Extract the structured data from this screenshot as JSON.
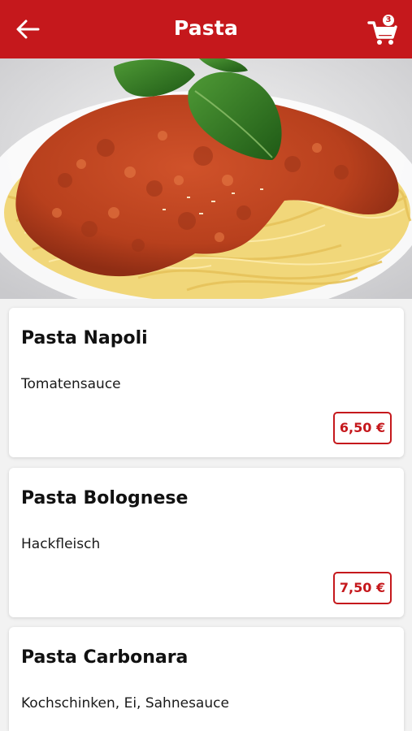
{
  "header": {
    "title": "Pasta",
    "cart_count": "3",
    "background_color": "#c5181c",
    "back_icon": "arrow-left-icon",
    "cart_icon": "shopping-cart-icon"
  },
  "hero": {
    "icon": "spaghetti-bolognese-photo"
  },
  "menu": {
    "items": [
      {
        "name": "Pasta Napoli",
        "description": "Tomatensauce",
        "price": "6,50 €"
      },
      {
        "name": "Pasta Bolognese",
        "description": "Hackfleisch",
        "price": "7,50 €"
      },
      {
        "name": "Pasta Carbonara",
        "description": "Kochschinken, Ei, Sahnesauce",
        "price": ""
      }
    ]
  }
}
